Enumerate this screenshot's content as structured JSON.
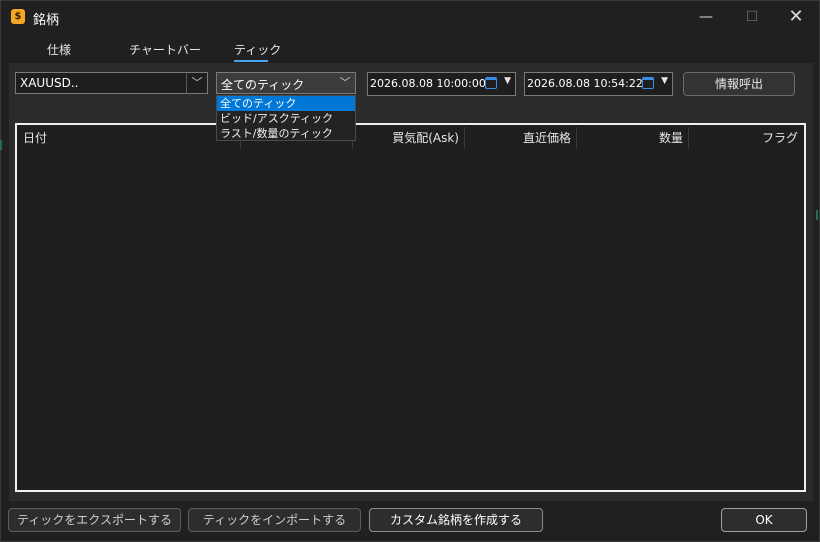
{
  "window": {
    "title": "銘柄",
    "app_icon_glyph": "$"
  },
  "tabs": [
    {
      "label": "仕様"
    },
    {
      "label": "チャートバー"
    },
    {
      "label": "ティック",
      "active": true
    }
  ],
  "toolbar": {
    "symbol_value": "XAUUSD..",
    "tick_type_value": "全てのティック",
    "date_from": "2026.08.08 10:00:00",
    "date_to": "2026.08.08 10:54:22",
    "request_label": "情報呼出"
  },
  "tick_type_options": [
    "全てのティック",
    "ビッド/アスクティック",
    "ラスト/数量のティック"
  ],
  "table": {
    "columns": [
      "日付",
      "",
      "買気配(Ask)",
      "直近価格",
      "数量",
      "フラグ"
    ],
    "rows": []
  },
  "footer": {
    "export_label": "ティックをエクスポートする",
    "import_label": "ティックをインポートする",
    "custom_label": "カスタム銘柄を作成する",
    "ok_label": "OK"
  },
  "colors": {
    "accent": "#0078d7",
    "tab_underline": "#4aa3f0",
    "app_icon": "#f5a623",
    "calendar_icon": "#3b8ee8"
  }
}
